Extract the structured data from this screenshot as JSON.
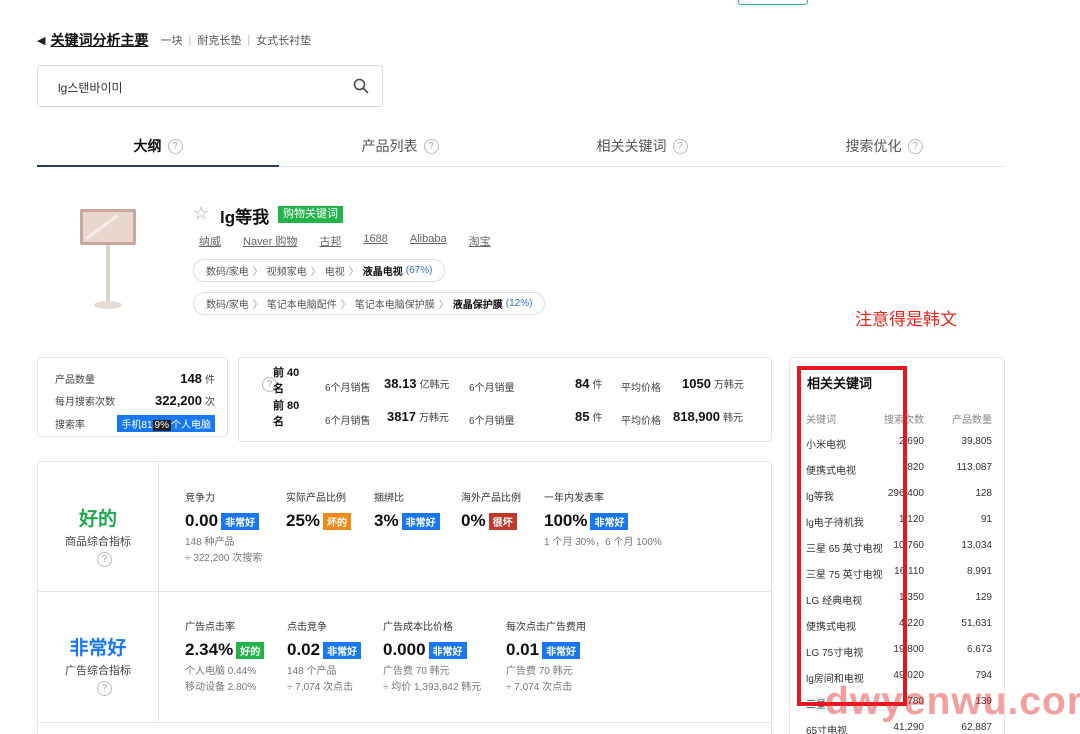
{
  "breadcrumb": {
    "back": "◀",
    "title": "关键词分析主要",
    "items": [
      "一块",
      "耐克长垫",
      "女式长衬垫"
    ]
  },
  "search": {
    "value": "lg스탠바이미"
  },
  "tabs": [
    {
      "label": "大纲",
      "active": true
    },
    {
      "label": "产品列表",
      "active": false
    },
    {
      "label": "相关关键词",
      "active": false
    },
    {
      "label": "搜索优化",
      "active": false
    }
  ],
  "help_glyph": "?",
  "product": {
    "title": "lg等我",
    "badge": "购物关键词",
    "links": [
      "纳威",
      "Naver 购物",
      "古邦",
      "1688",
      "Alibaba",
      "淘宝"
    ],
    "cat1": {
      "path": [
        "数码/家电",
        "视频家电",
        "电视"
      ],
      "leaf": "液晶电视",
      "pct": "(67%)"
    },
    "cat2": {
      "path": [
        "数码/家电",
        "笔记本电脑配件",
        "笔记本电脑保护膜"
      ],
      "leaf": "液晶保护膜",
      "pct": "(12%)"
    }
  },
  "note": "注意得是韩文",
  "stats1": {
    "count_label": "产品数量",
    "count_value": "148",
    "count_unit": "件",
    "search_label": "每月搜索次数",
    "search_value": "322,200",
    "search_unit": "次",
    "rate_label": "搜索率",
    "rate_tag": "手机81",
    "rate_tag_hl": "9%",
    "rate_tag_rest": "个人电脑"
  },
  "stats2": {
    "rank1": "前 40 名",
    "rank2": "前 80 名",
    "rows": [
      {
        "l1": "6个月销售",
        "v1": "38.13",
        "u1": "亿韩元",
        "l2": "6个月销量",
        "v2": "84",
        "u2": "件",
        "l3": "平均价格",
        "v3": "1050",
        "u3": "万韩元"
      },
      {
        "l1": "6个月销售",
        "v1": "3817",
        "u1": "万韩元",
        "l2": "6个月销量",
        "v2": "85",
        "u2": "件",
        "l3": "平均价格",
        "v3": "818,900",
        "u3": "韩元"
      }
    ]
  },
  "goods": {
    "grade": "好的",
    "sub": "商品综合指标",
    "metrics": [
      {
        "label": "竞争力",
        "value": "0.00",
        "tag": "非常好",
        "sub1": "148 种产品",
        "sub2": "÷ 322,200 次搜索"
      },
      {
        "label": "实际产品比例",
        "value": "25%",
        "tag": "坏的",
        "sub1": "",
        "sub2": ""
      },
      {
        "label": "捆绑比",
        "value": "3%",
        "tag": "非常好",
        "sub1": "",
        "sub2": ""
      },
      {
        "label": "海外产品比例",
        "value": "0%",
        "tag": "很坏",
        "sub1": "",
        "sub2": ""
      },
      {
        "label": "一年内发表率",
        "value": "100%",
        "tag": "非常好",
        "sub1": "1 个月 30%，6 个月 100%",
        "sub2": ""
      }
    ]
  },
  "ads": {
    "grade": "非常好",
    "sub": "广告综合指标",
    "metrics": [
      {
        "label": "广告点击率",
        "value": "2.34%",
        "tag": "好的",
        "sub1": "个人电脑 0.44%",
        "sub2": "移动设备 2.80%"
      },
      {
        "label": "点击竞争",
        "value": "0.02",
        "tag": "非常好",
        "sub1": "148 个产品",
        "sub2": "÷ 7,074 次点击"
      },
      {
        "label": "广告成本比价格",
        "value": "0.000",
        "tag": "非常好",
        "sub1": "广告费 70 韩元",
        "sub2": "÷ 均价 1,393,842 韩元"
      },
      {
        "label": "每次点击广告费用",
        "value": "0.01",
        "tag": "非常好",
        "sub1": "广告费 70 韩元",
        "sub2": "÷ 7,074 次点击"
      }
    ]
  },
  "related": {
    "title": "相关关键词",
    "headers": [
      "关键词",
      "搜索次数",
      "产品数量"
    ],
    "rows": [
      [
        "小米电视",
        "2,690",
        "39,805"
      ],
      [
        "便携式电视",
        "820",
        "113,087"
      ],
      [
        "lg等我",
        "296,400",
        "128"
      ],
      [
        "lg电子待机我",
        "1,120",
        "91"
      ],
      [
        "三星 65 英寸电视",
        "10,760",
        "13,034"
      ],
      [
        "三星 75 英寸电视",
        "16,110",
        "8,991"
      ],
      [
        "LG 经典电视",
        "1,350",
        "129"
      ],
      [
        "便携式电视",
        "4,220",
        "51,631"
      ],
      [
        "LG 75寸电视",
        "19,800",
        "6,673"
      ],
      [
        "lg房间和电视",
        "49,020",
        "794"
      ],
      [
        "三星",
        "780",
        "139"
      ],
      [
        "65寸电视",
        "41,290",
        "62,887"
      ]
    ]
  },
  "watermark": "dwyenwu.com",
  "colors": {
    "accent_blue": "#1877f2",
    "good_green": "#22b34a",
    "note_red": "#e8291c"
  }
}
